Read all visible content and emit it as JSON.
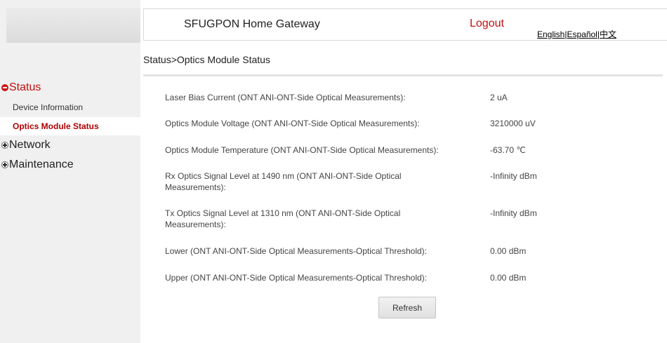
{
  "header": {
    "title": "SFUGPON Home Gateway",
    "logout": "Logout",
    "languages": [
      "English",
      "Español",
      "中文"
    ],
    "separator": "|"
  },
  "breadcrumb": "Status>Optics Module Status",
  "sidebar": {
    "groups": [
      {
        "label": "Status",
        "expanded": true,
        "icon": "minus-circle-icon"
      },
      {
        "label": "Network",
        "expanded": false,
        "icon": "plus-box-icon"
      },
      {
        "label": "Maintenance",
        "expanded": false,
        "icon": "plus-box-icon"
      }
    ],
    "status_items": [
      {
        "label": "Device Information",
        "active": false
      },
      {
        "label": "Optics Module Status",
        "active": true
      }
    ]
  },
  "rows": [
    {
      "label": "Laser Bias Current (ONT ANI-ONT-Side Optical Measurements):",
      "value": "2 uA"
    },
    {
      "label": "Optics Module Voltage (ONT ANI-ONT-Side Optical Measurements):",
      "value": "3210000 uV"
    },
    {
      "label": "Optics Module Temperature (ONT ANI-ONT-Side Optical Measurements):",
      "value": "-63.70 ℃"
    },
    {
      "label": "Rx Optics Signal Level at 1490 nm (ONT ANI-ONT-Side Optical Measurements):",
      "value": "-Infinity dBm"
    },
    {
      "label": "Tx Optics Signal Level at 1310 nm (ONT ANI-ONT-Side Optical Measurements):",
      "value": "-Infinity dBm"
    },
    {
      "label": "Lower (ONT ANI-ONT-Side Optical Measurements-Optical Threshold):",
      "value": "0.00 dBm"
    },
    {
      "label": "Upper (ONT ANI-ONT-Side Optical Measurements-Optical Threshold):",
      "value": "0.00 dBm"
    }
  ],
  "refresh_label": "Refresh",
  "colors": {
    "accent_red": "#c01010",
    "sidebar_bg": "#f0f0f0"
  }
}
